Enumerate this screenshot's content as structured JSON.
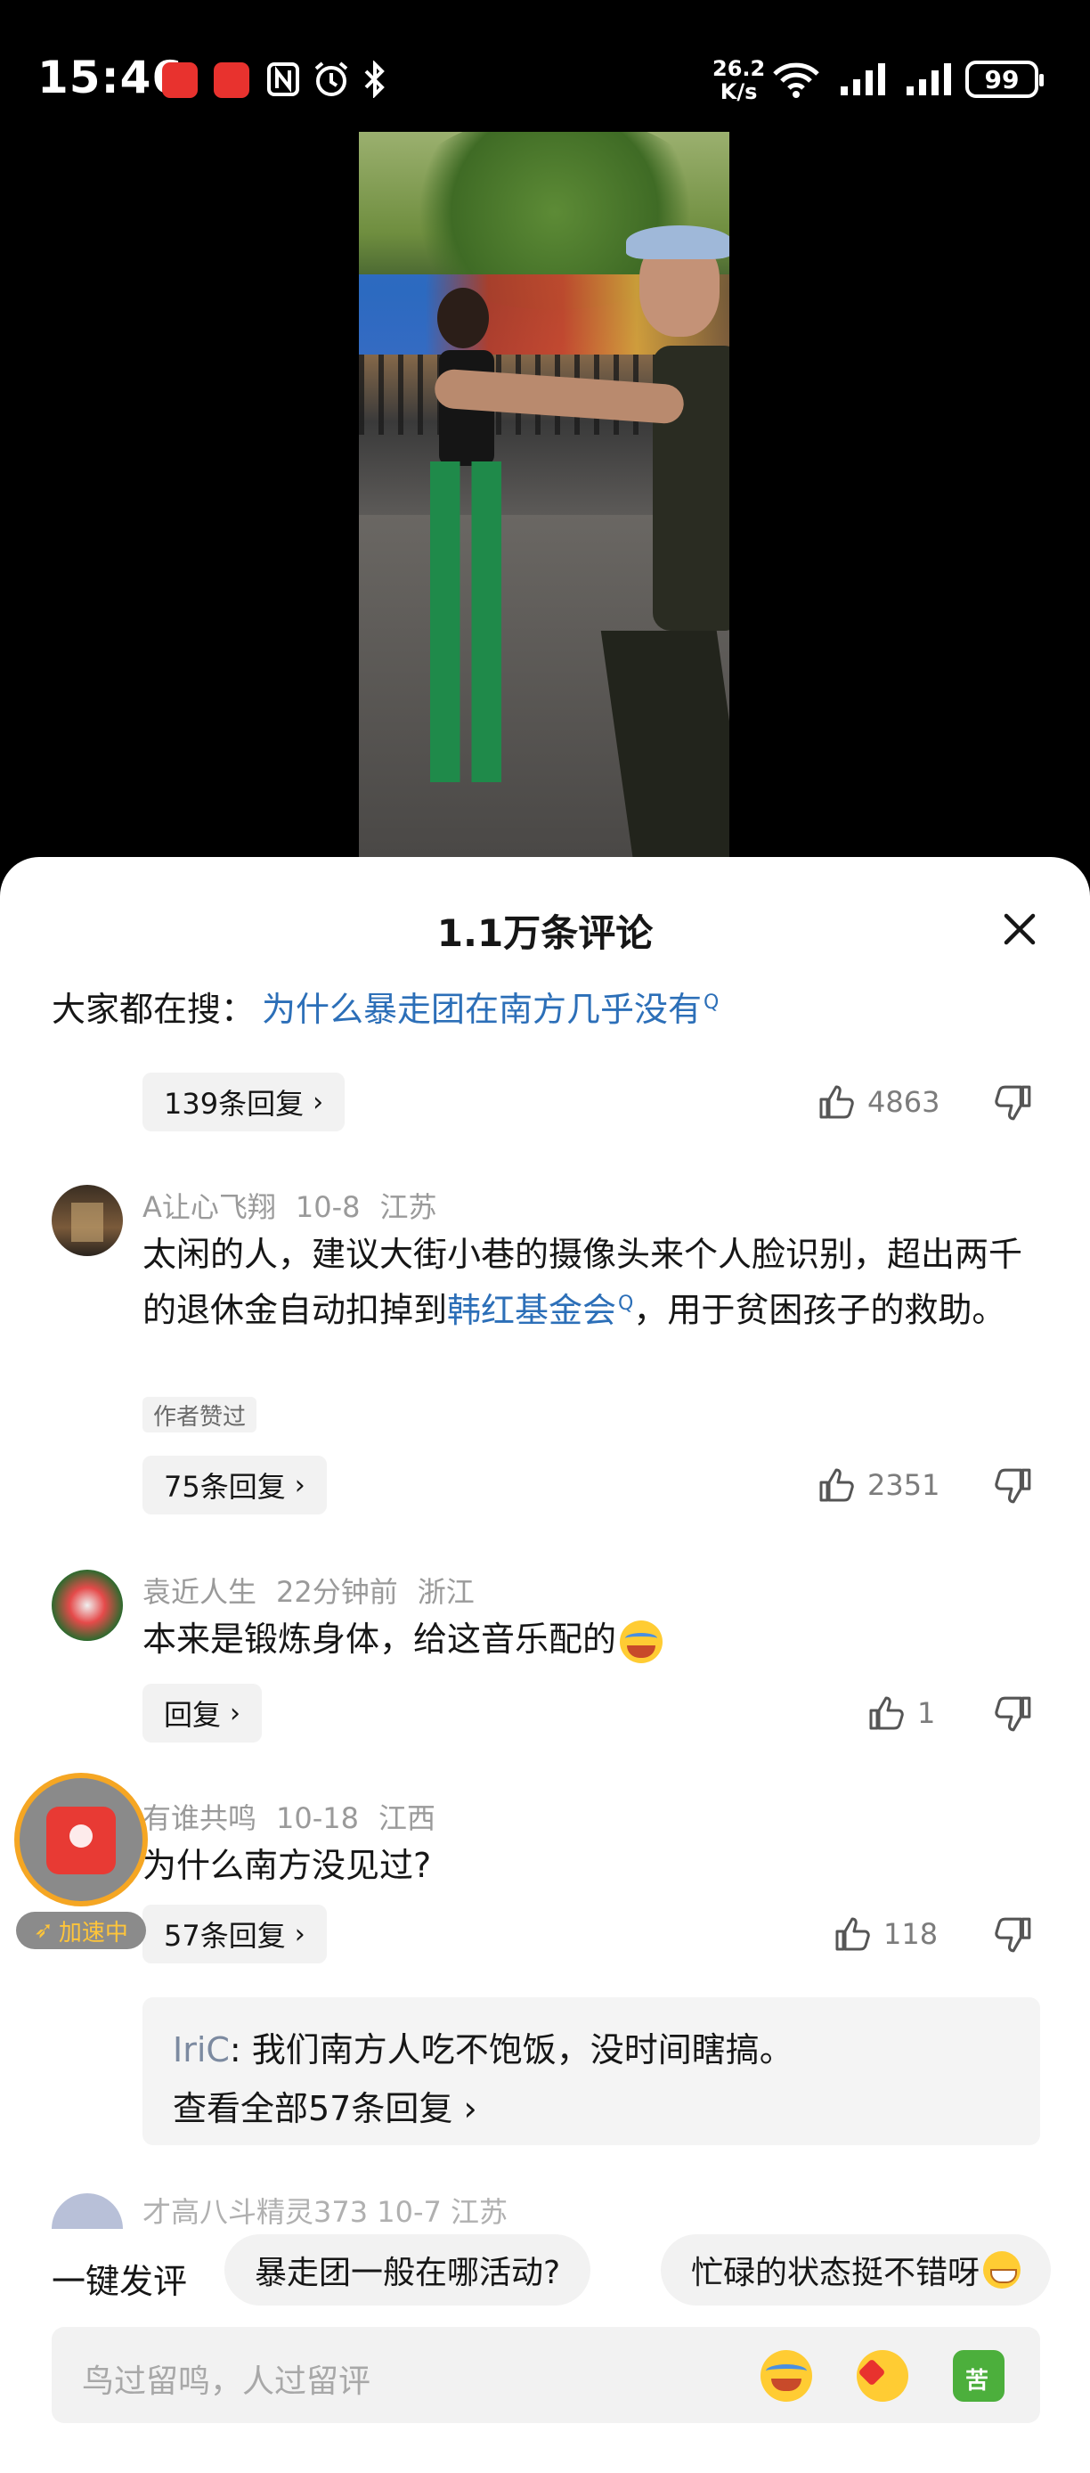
{
  "status_bar": {
    "time": "15:46",
    "net_speed_top": "26.2",
    "net_speed_bottom": "K/s",
    "battery": "99"
  },
  "comments_panel": {
    "title": "1.1万条评论",
    "search_prefix": "大家都在搜：",
    "search_link": "为什么暴走团在南方几乎没有",
    "first_block": {
      "reply_pill": "139条回复",
      "likes": "4863"
    },
    "comments": [
      {
        "user": "A让心飞翔",
        "date": "10-8",
        "region": "江苏",
        "text_part1": "太闲的人，建议大街小巷的摄像头来个人脸识别，超出两千的退休金自动扣掉到",
        "text_link": "韩红基金会",
        "text_part2": "，用于贫困孩子的救助。",
        "author_tag": "作者赞过",
        "reply_pill": "75条回复",
        "likes": "2351"
      },
      {
        "user": "袁近人生",
        "date": "22分钟前",
        "region": "浙江",
        "text": "本来是锻炼身体，给这音乐配的",
        "reply_pill": "回复",
        "likes": "1"
      },
      {
        "user": "有谁共鸣",
        "date": "10-18",
        "region": "江西",
        "text": "为什么南方没见过?",
        "reply_pill": "57条回复",
        "likes": "118",
        "sub_reply": {
          "name": "IriC",
          "text": ": 我们南方人吃不饱饭，没时间瞎搞。",
          "view_all": "查看全部57条回复"
        }
      }
    ],
    "partial_next": "才高八斗精灵373  10-7  江苏",
    "floating_widget_label": "加速中"
  },
  "quick_comments": {
    "label": "一键发评",
    "chips": [
      "暴走团一般在哪活动?",
      "忙碌的状态挺不错呀"
    ]
  },
  "input": {
    "placeholder": "鸟过留鸣，人过留评"
  },
  "colors": {
    "link": "#2c6fb8",
    "accent_orange": "#f5a623",
    "badge_red": "#e8322e"
  }
}
